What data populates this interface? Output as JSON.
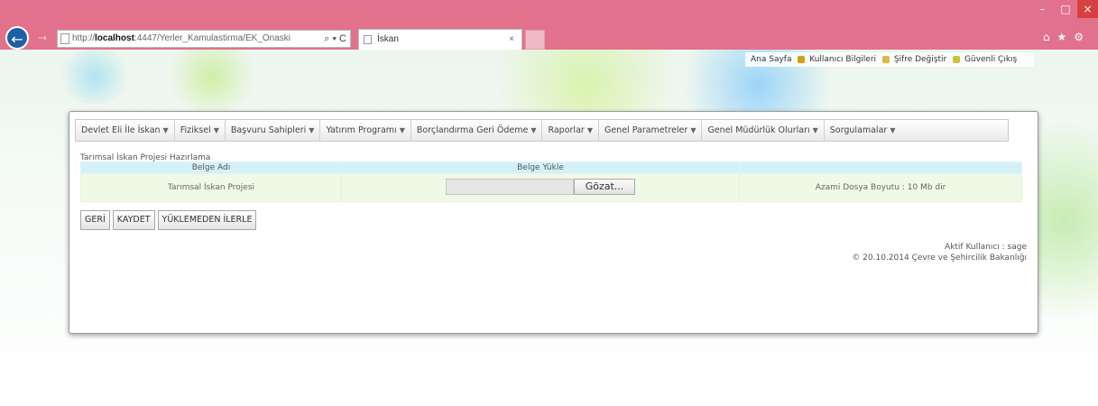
{
  "browser": {
    "url_prefix": "http://",
    "url_host": "localhost",
    "url_rest": ":4447/Yerler_Kamulastirma/EK_Onaski",
    "address_tools": "⌕ ▾ C",
    "tab_title": "İskan",
    "tab_close": "×",
    "window_min": "–",
    "window_max": "□",
    "window_close": "×",
    "chrome_icons": "⌂★⚙"
  },
  "toplinks": {
    "home": "Ana Sayfa",
    "user_info": "Kullanıcı Bilgileri",
    "change_password": "Şifre Değiştir",
    "logout": "Güvenli Çıkış"
  },
  "menu": [
    {
      "label": "Devlet Eli İle İskan"
    },
    {
      "label": "Fiziksel"
    },
    {
      "label": "Başvuru Sahipleri"
    },
    {
      "label": "Yatırım Programı"
    },
    {
      "label": "Borçlandırma Geri Ödeme"
    },
    {
      "label": "Raporlar"
    },
    {
      "label": "Genel Parametreler"
    },
    {
      "label": "Genel Müdürlük Olurları"
    },
    {
      "label": "Sorgulamalar"
    }
  ],
  "section_title": "Tarımsal İskan Projesi Hazırlama",
  "grid": {
    "headers": [
      "Belge Adı",
      "Belge Yükle",
      ""
    ],
    "row": {
      "doc_name": "Tarımsal İskan Projesi",
      "browse_label": "Gözat...",
      "max_size": "Azami Dosya Boyutu : 10 Mb dir"
    }
  },
  "buttons": {
    "back": "GERİ",
    "save": "KAYDET",
    "skip_upload": "YÜKLEMEDEN İLERLE"
  },
  "footer": {
    "active_user": "Aktif Kullanıcı : sage",
    "copyright": "© 20.10.2014 Çevre ve Şehircilik Bakanlığı"
  },
  "colors": {
    "chrome": "#e2728b",
    "table_header": "#d5f1f8",
    "table_row": "#f0f9e6"
  }
}
